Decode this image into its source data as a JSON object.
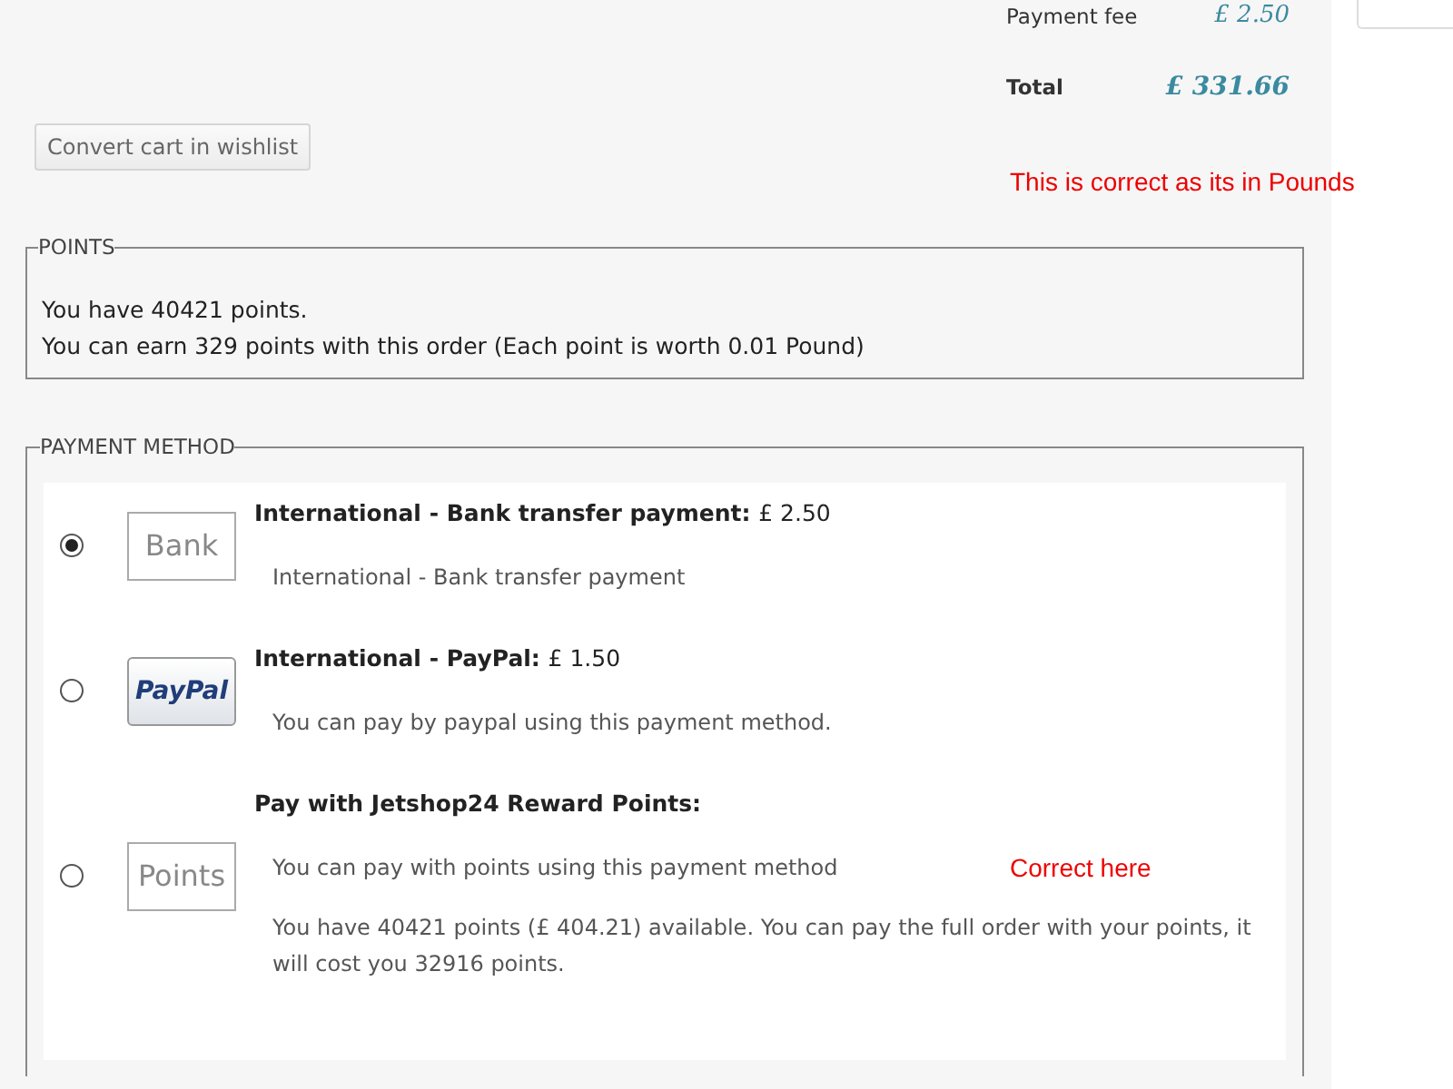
{
  "totals": [
    {
      "label": "Payment fee",
      "amount": "£ 2.50",
      "kind": "fee"
    },
    {
      "label": "Total",
      "amount": "£ 331.66",
      "kind": "total"
    }
  ],
  "wishlist_button": "Convert cart in wishlist",
  "top_note": "This is correct as its in Pounds",
  "points": {
    "legend": "POINTS",
    "lines": [
      "You have 40421 points.",
      "You can earn 329 points with this order (Each point is worth 0.01 Pound)"
    ]
  },
  "payment": {
    "legend": "PAYMENT METHOD",
    "methods": [
      {
        "kind": "bank",
        "logo": "Bank",
        "title": "International - Bank transfer payment:",
        "price": "£ 2.50",
        "description": "International - Bank transfer payment",
        "selected": true
      },
      {
        "kind": "paypal",
        "logo": "PayPal",
        "title": "International - PayPal:",
        "price": "£ 1.50",
        "description": "You can pay by paypal using this payment method.",
        "selected": false
      },
      {
        "kind": "points",
        "logo": "Points",
        "title": "Pay with Jetshop24 Reward Points:",
        "description": "You can pay with points using this payment method",
        "note": "Correct here",
        "details": "You have 40421 points (£ 404.21) available. You can pay the full order with your points, it will cost you 32916 points.",
        "selected": false
      }
    ]
  }
}
